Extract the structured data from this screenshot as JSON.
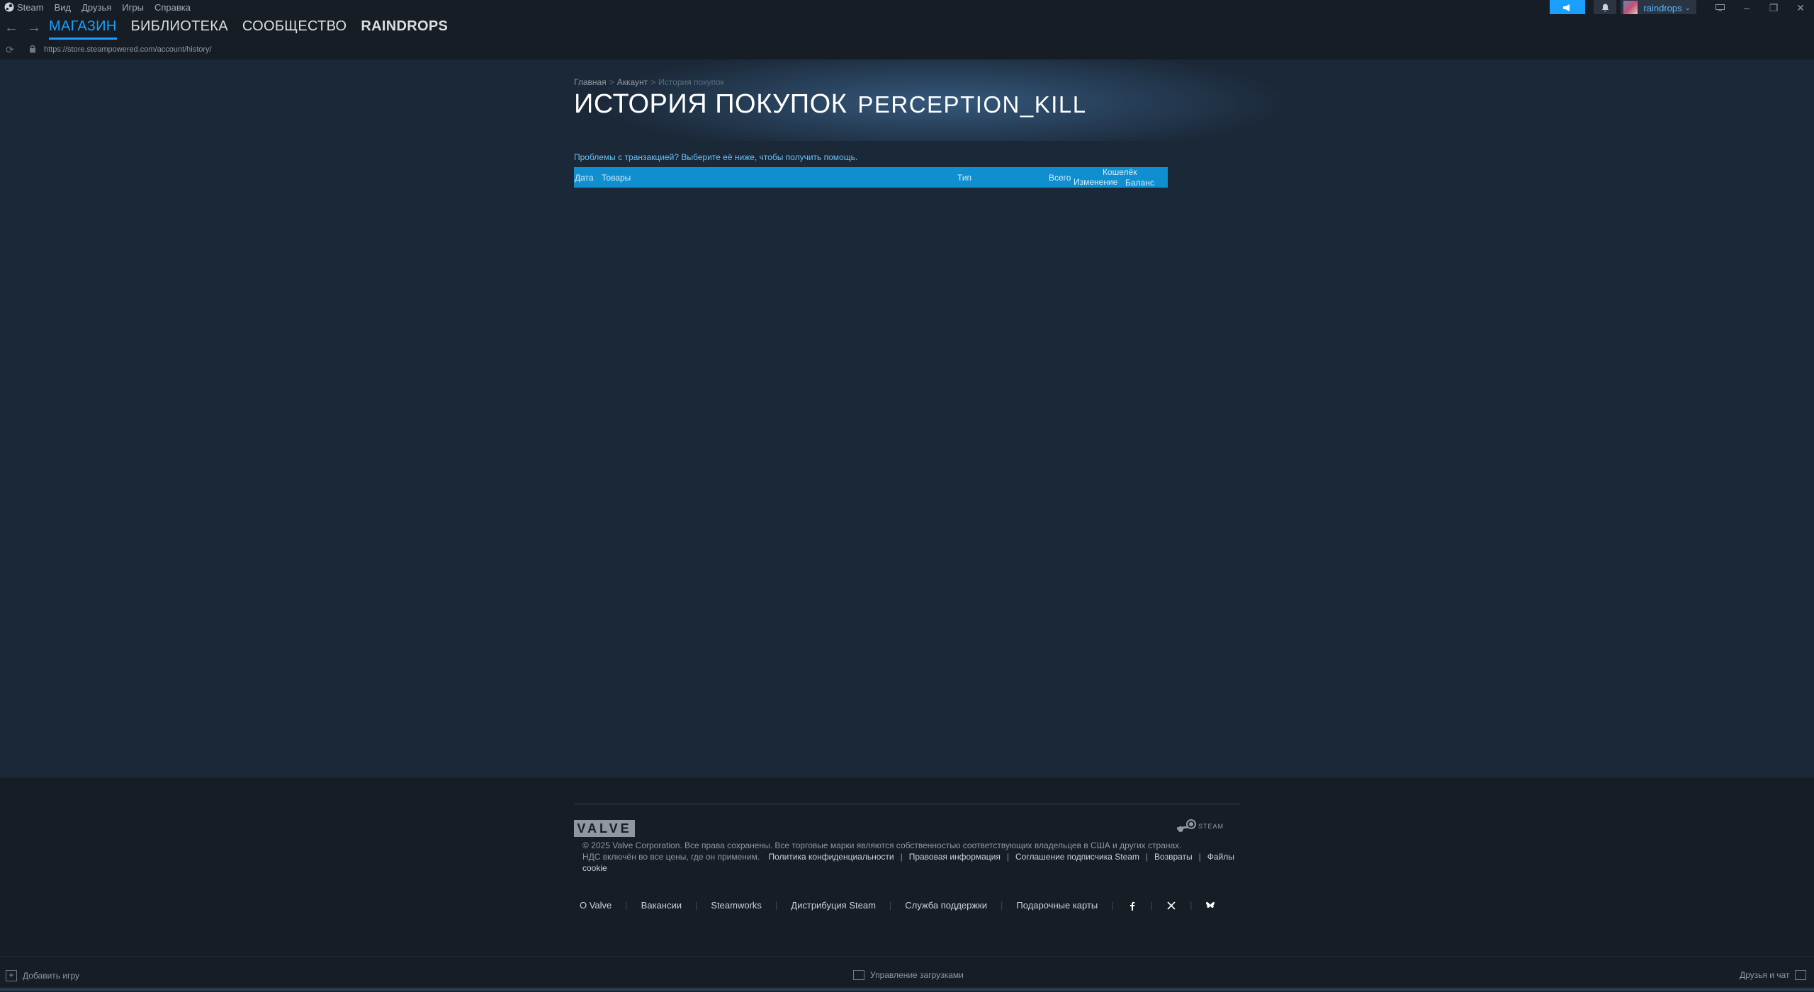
{
  "menubar": {
    "app_name": "Steam",
    "items": [
      "Вид",
      "Друзья",
      "Игры",
      "Справка"
    ]
  },
  "account": {
    "username": "raindrops"
  },
  "nav": {
    "tabs": [
      "МАГАЗИН",
      "БИБЛИОТЕКА",
      "СООБЩЕСТВО",
      "RAINDROPS"
    ],
    "active_tab": "МАГАЗИН"
  },
  "url": "https://store.steampowered.com/account/history/",
  "breadcrumbs": [
    "Главная",
    "Аккаунт",
    "История покупок"
  ],
  "page": {
    "title": "ИСТОРИЯ ПОКУПОК",
    "account_name": "PERCEPTION_KILL",
    "help_link": "Проблемы с транзакцией? Выберите её ниже, чтобы получить помощь."
  },
  "table": {
    "headers": {
      "date": "Дата",
      "items": "Товары",
      "type": "Тип",
      "total": "Всего",
      "wallet": "Кошелёк",
      "change": "Изменение",
      "balance": "Баланс"
    },
    "rows": []
  },
  "footer": {
    "valve_logo": "VALVE",
    "steam_logo": "STEAM",
    "copyright": "© 2025 Valve Corporation. Все права сохранены. Все торговые марки являются собственностью соответствующих владельцев в США и других странах.",
    "vat_note": "НДС включён во все цены, где он применим.",
    "legal_links": [
      "Политика конфиденциальности",
      "Правовая информация",
      "Соглашение подписчика Steam",
      "Возвраты",
      "Файлы cookie"
    ],
    "links": [
      "О Valve",
      "Вакансии",
      "Steamworks",
      "Дистрибуция Steam",
      "Служба поддержки",
      "Подарочные карты"
    ],
    "social_icons": [
      "facebook-icon",
      "x-icon",
      "bluesky-icon"
    ]
  },
  "bottombar": {
    "add_game": "Добавить игру",
    "downloads": "Управление загрузками",
    "friends": "Друзья и чат"
  },
  "colors": {
    "background": "#1b2838",
    "chrome": "#171d25",
    "accent": "#1a9fff",
    "table_header": "#0f8fd0",
    "link": "#67c1f5"
  }
}
